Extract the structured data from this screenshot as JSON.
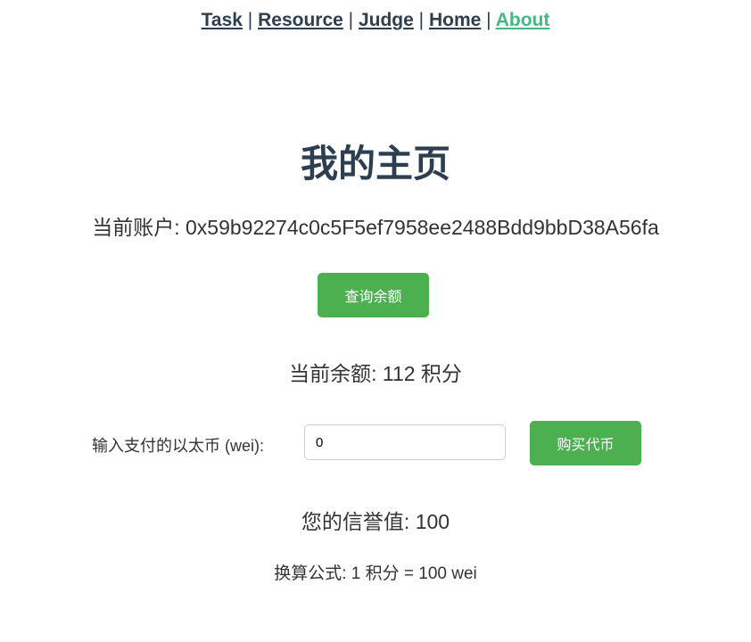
{
  "nav": {
    "items": [
      "Task",
      "Resource",
      "Judge",
      "Home",
      "About"
    ],
    "separator": "|",
    "active": "About",
    "active_color": "#42b983"
  },
  "title": "我的主页",
  "account": {
    "label": "当前账户:",
    "address": "0x59b92274c0c5F5ef7958ee2488Bdd9bbD38A56fa"
  },
  "query_button": "查询余额",
  "balance": {
    "label": "当前余额:",
    "value": "112",
    "unit": "积分"
  },
  "purchase": {
    "label": "输入支付的以太币 (wei):",
    "input_value": "0",
    "button": "购买代币"
  },
  "reputation": {
    "label": "您的信誉值:",
    "value": "100"
  },
  "formula": "换算公式: 1 积分 = 100 wei",
  "button_color": "#4caf50"
}
